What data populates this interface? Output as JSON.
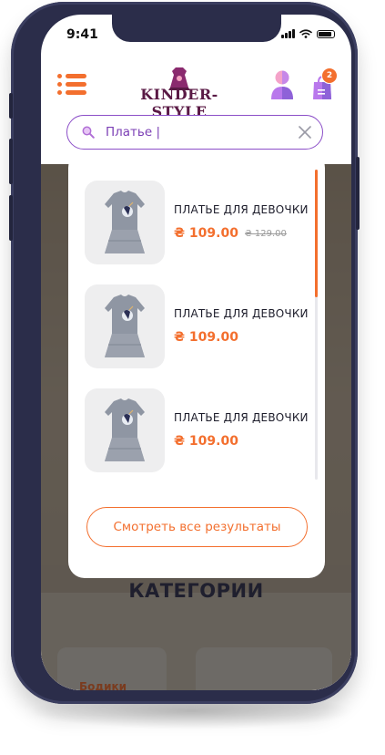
{
  "status_bar": {
    "time": "9:41"
  },
  "header": {
    "logo_text": "KINDER-STYLE",
    "cart_count": "2",
    "accent_color": "#f36f2e",
    "brand_color": "#5a1a45"
  },
  "search": {
    "value": "Платье |"
  },
  "dropdown": {
    "products": [
      {
        "name": "ПЛАТЬЕ ДЛЯ ДЕВОЧКИ",
        "price": "₴ 109.00",
        "old_price": "₴ 129.00"
      },
      {
        "name": "ПЛАТЬЕ ДЛЯ ДЕВОЧКИ",
        "price": "₴ 109.00",
        "old_price": ""
      },
      {
        "name": "ПЛАТЬЕ ДЛЯ ДЕВОЧКИ",
        "price": "₴ 109.00",
        "old_price": ""
      }
    ],
    "see_all_label": "Смотреть все результаты"
  },
  "background_page": {
    "heading": "КАТЕГОРИИ",
    "card_label": "Бодики"
  }
}
